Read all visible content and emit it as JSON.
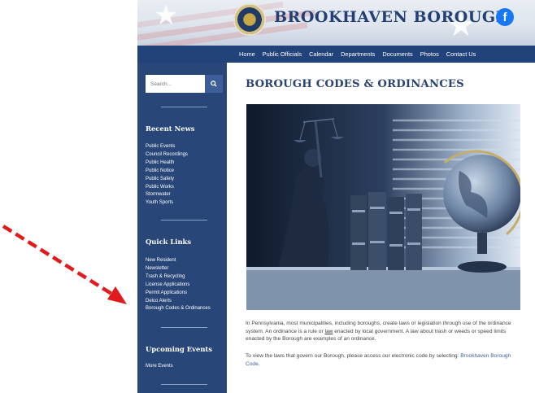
{
  "header": {
    "site_title": "BROOKHAVEN BOROUGH",
    "facebook_icon": "f"
  },
  "nav": {
    "items": [
      "Home",
      "Public Officials",
      "Calendar",
      "Departments",
      "Documents",
      "Photos",
      "Contact Us"
    ]
  },
  "sidebar": {
    "search": {
      "placeholder": "Search..."
    },
    "recent_news": {
      "heading": "Recent News",
      "items": [
        "Public Events",
        "Council Recordings",
        "Public Health",
        "Public Notice",
        "Public Safety",
        "Public Works",
        "Stormwater",
        "Youth Sports"
      ]
    },
    "quick_links": {
      "heading": "Quick Links",
      "items": [
        "New Resident",
        "Newsletter",
        "Trash & Recycling",
        "License Applications",
        "Permit Applications",
        "Delco Alerts",
        "Borough Codes & Ordinances"
      ]
    },
    "upcoming_events": {
      "heading": "Upcoming Events",
      "items": [
        "More Events"
      ]
    }
  },
  "main": {
    "title": "BOROUGH CODES & ORDINANCES",
    "para1": {
      "before": "In Pennsylvania, most municipalities, including boroughs, create laws or legislation through use of the ordinance system. An ordinance is a rule or ",
      "link": "law",
      "after": " enacted by local government. A law about trash or weeds or speed limits enacted by the Borough are examples of an ordinance."
    },
    "para2": {
      "before": "To view the laws that govern our Borough, please access our electronic code by selecting: ",
      "link": "Brookhaven Borough Code",
      "after": "."
    }
  },
  "colors": {
    "nav_bg": "#22437a",
    "sidebar_bg": "#284677",
    "title_color": "#2a4270",
    "annotation_arrow": "#e01b1b"
  }
}
